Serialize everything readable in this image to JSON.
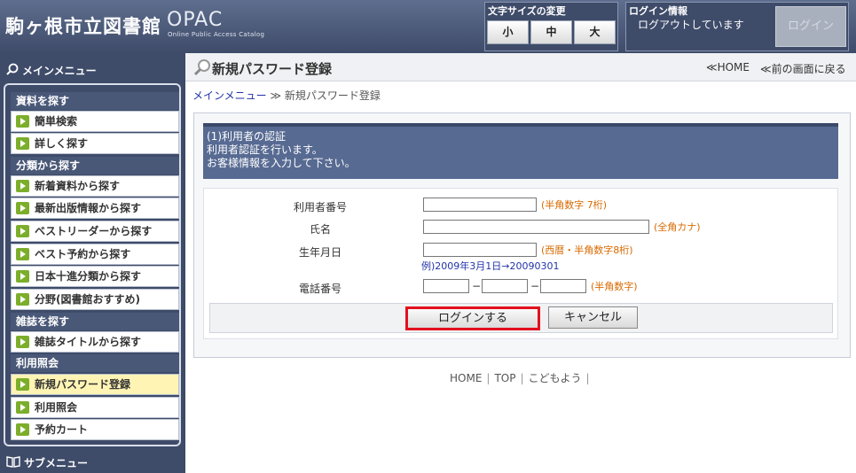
{
  "header": {
    "site_title": "駒ヶ根市立図書館",
    "logo_text": "OPAC",
    "logo_sub": "Online Public Access Catalog",
    "font_size": {
      "title": "文字サイズの変更",
      "small": "小",
      "medium": "中",
      "large": "大"
    },
    "login_info": {
      "title": "ログイン情報",
      "status": "ログアウトしています",
      "button": "ログイン"
    }
  },
  "sidebar": {
    "menu_title": "メインメニュー",
    "sections": [
      {
        "title": "資料を探す",
        "items": [
          "簡単検索",
          "詳しく探す"
        ]
      },
      {
        "title": "分類から探す",
        "items": [
          "新着資料から探す",
          "最新出版情報から探す",
          "ベストリーダーから探す",
          "ベスト予約から探す",
          "日本十進分類から探す",
          "分野(図書館おすすめ)"
        ]
      },
      {
        "title": "雑誌を探す",
        "items": [
          "雑誌タイトルから探す"
        ]
      },
      {
        "title": "利用照会",
        "items": [
          "新規パスワード登録",
          "利用照会",
          "予約カート"
        ]
      }
    ],
    "submenu_title": "サブメニュー"
  },
  "main": {
    "page_title": "新規パスワード登録",
    "home_link": "≪HOME",
    "back_link": "≪前の画面に戻る",
    "breadcrumb": {
      "root": "メインメニュー",
      "sep": " ≫ ",
      "current": "新規パスワード登録"
    },
    "info": {
      "line1": "(1)利用者の認証",
      "line2": "利用者認証を行います。",
      "line3": "お客様情報を入力して下さい。"
    },
    "form": {
      "user_no_label": "利用者番号",
      "user_no_hint": "(半角数字 7桁)",
      "name_label": "氏名",
      "name_hint": "(全角カナ)",
      "birth_label": "生年月日",
      "birth_hint": "(西暦・半角数字8桁)",
      "birth_example": "例)2009年3月1日→20090301",
      "phone_label": "電話番号",
      "phone_hint": "(半角数字)",
      "dash": "−"
    },
    "buttons": {
      "login": "ログインする",
      "cancel": "キャンセル"
    },
    "footer": {
      "home": "HOME",
      "top": "TOP",
      "kids": "こどもよう",
      "sep": "|"
    }
  }
}
